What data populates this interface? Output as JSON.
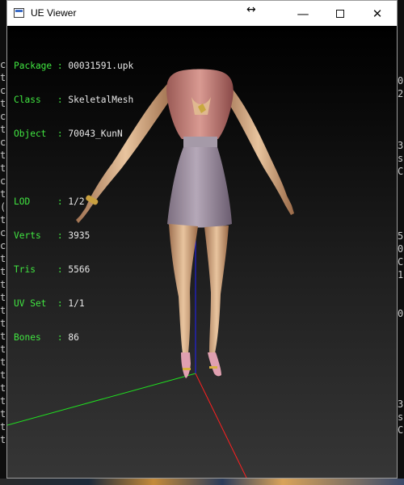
{
  "window": {
    "title": "UE Viewer",
    "controls": {
      "minimize": "—",
      "maximize": "",
      "close": "✕"
    }
  },
  "info": [
    {
      "key": "Package",
      "sep": " : ",
      "value": "00031591.upk"
    },
    {
      "key": "Class  ",
      "sep": " : ",
      "value": "SkeletalMesh"
    },
    {
      "key": "Object ",
      "sep": " : ",
      "value": "70043_KunN"
    }
  ],
  "stats": [
    {
      "key": "LOD    ",
      "sep": " : ",
      "value": "1/2"
    },
    {
      "key": "Verts  ",
      "sep": " : ",
      "value": "3935"
    },
    {
      "key": "Tris   ",
      "sep": " : ",
      "value": "5566"
    },
    {
      "key": "UV Set ",
      "sep": " : ",
      "value": "1/1"
    },
    {
      "key": "Bones  ",
      "sep": " : ",
      "value": "86"
    }
  ],
  "background_text": {
    "left": "c\nt\nc\nt\nc\nt\nc\nt\nt\nc\nt\n(\nt\nc\nc\nt\nt\nt\nt\nt\nt\nt\nt\nt\nt\nt\nt\nt\nt\nt",
    "right": "0\n2\n\n\n\n3\ns\nC\n\n\n\n\n5\n0\nC\n1\n\n\n0\n\n\n\n\n\n\n3\ns\nC"
  },
  "colors": {
    "axis_x": "#ff2020",
    "axis_y": "#20e020",
    "axis_z": "#2020ff",
    "info_key": "#41e641",
    "info_value": "#e8e8e8"
  }
}
